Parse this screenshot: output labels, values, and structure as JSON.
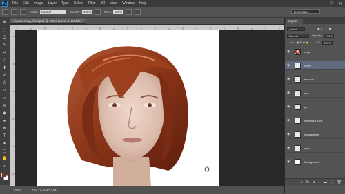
{
  "app": {
    "logo": "Ps"
  },
  "menu": [
    "File",
    "Edit",
    "Image",
    "Layer",
    "Type",
    "Select",
    "Filter",
    "3D",
    "View",
    "Window",
    "Help"
  ],
  "window_controls": [
    "–",
    "□",
    "✕"
  ],
  "options": {
    "mode_label": "Mode:",
    "mode_value": "Normal",
    "opacity_label": "Opacity:",
    "opacity_value": "100%",
    "flow_label": "Flow:",
    "flow_value": "100%",
    "workspace": "Essentials"
  },
  "document": {
    "tab_title": "Чертеж лица_final.psd @ 100% (Layer 1, RGB/8) *",
    "zoom": "100%",
    "doc_info": "Doc: 1,40M/14,9M"
  },
  "layers_panel": {
    "tab_label": "Layers",
    "filter_value": "ρ Kind",
    "blend_mode": "Normal",
    "opacity_label": "Opacity:",
    "opacity_value": "100%",
    "lock_label": "Lock:",
    "fill_label": "Fill:",
    "fill_value": "100%",
    "layers": [
      {
        "name": "лицо",
        "thumb": "face",
        "selected": false
      },
      {
        "name": "Layer 1",
        "thumb": "trans",
        "selected": true
      },
      {
        "name": "волосы",
        "thumb": "trans",
        "selected": false
      },
      {
        "name": "нос",
        "thumb": "trans",
        "selected": false
      },
      {
        "name": "рот",
        "thumb": "trans",
        "selected": false
      },
      {
        "name": "прическа челк",
        "thumb": "trans",
        "selected": false
      },
      {
        "name": "упражнение",
        "thumb": "trans",
        "selected": false
      },
      {
        "name": "цвет",
        "thumb": "trans",
        "selected": false
      },
      {
        "name": "Background",
        "thumb": "white",
        "selected": false
      }
    ],
    "bottom_icons": [
      "link-icon",
      "fx-icon",
      "mask-icon",
      "adjustment-icon",
      "folder-icon",
      "new-layer-icon",
      "trash-icon"
    ]
  },
  "colors": {
    "hair": "#8a3418",
    "skin": "#e4c8b8",
    "foreground": "#7a3020",
    "background": "#ffffff"
  }
}
